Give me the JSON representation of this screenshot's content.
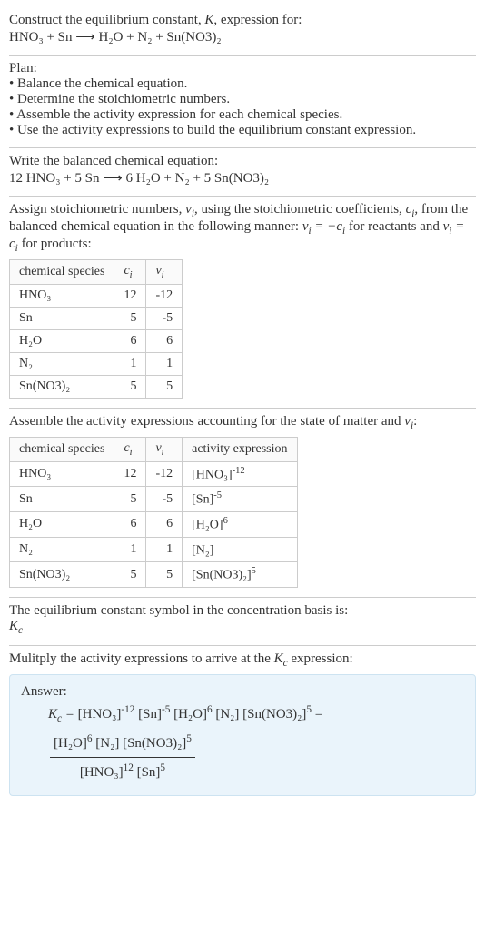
{
  "header": {
    "line1": "Construct the equilibrium constant, K, expression for:",
    "line2": "HNO₃ + Sn ⟶ H₂O + N₂ + Sn(NO3)₂"
  },
  "plan": {
    "title": "Plan:",
    "b1": "• Balance the chemical equation.",
    "b2": "• Determine the stoichiometric numbers.",
    "b3": "• Assemble the activity expression for each chemical species.",
    "b4": "• Use the activity expressions to build the equilibrium constant expression."
  },
  "balanced": {
    "title": "Write the balanced chemical equation:",
    "eq": "12 HNO₃ + 5 Sn ⟶ 6 H₂O + N₂ + 5 Sn(NO3)₂"
  },
  "stoich": {
    "intro_a": "Assign stoichiometric numbers, ",
    "intro_b": ", using the stoichiometric coefficients, ",
    "intro_c": ", from the balanced chemical equation in the following manner: ",
    "intro_d": " for reactants and ",
    "intro_e": " for products:",
    "table": {
      "h1": "chemical species",
      "h2": "cᵢ",
      "h3": "νᵢ",
      "rows": [
        {
          "sp": "HNO₃",
          "c": "12",
          "v": "-12"
        },
        {
          "sp": "Sn",
          "c": "5",
          "v": "-5"
        },
        {
          "sp": "H₂O",
          "c": "6",
          "v": "6"
        },
        {
          "sp": "N₂",
          "c": "1",
          "v": "1"
        },
        {
          "sp": "Sn(NO3)₂",
          "c": "5",
          "v": "5"
        }
      ]
    }
  },
  "activity": {
    "intro_a": "Assemble the activity expressions accounting for the state of matter and ",
    "intro_b": ":",
    "table": {
      "h1": "chemical species",
      "h2": "cᵢ",
      "h3": "νᵢ",
      "h4": "activity expression",
      "rows": [
        {
          "sp": "HNO₃",
          "c": "12",
          "v": "-12",
          "act_base": "[HNO₃]",
          "act_exp": "-12"
        },
        {
          "sp": "Sn",
          "c": "5",
          "v": "-5",
          "act_base": "[Sn]",
          "act_exp": "-5"
        },
        {
          "sp": "H₂O",
          "c": "6",
          "v": "6",
          "act_base": "[H₂O]",
          "act_exp": "6"
        },
        {
          "sp": "N₂",
          "c": "1",
          "v": "1",
          "act_base": "[N₂]",
          "act_exp": ""
        },
        {
          "sp": "Sn(NO3)₂",
          "c": "5",
          "v": "5",
          "act_base": "[Sn(NO3)₂]",
          "act_exp": "5"
        }
      ]
    }
  },
  "symbol": {
    "line": "The equilibrium constant symbol in the concentration basis is:",
    "sym": "K_c"
  },
  "multiply": {
    "line_a": "Mulitply the activity expressions to arrive at the ",
    "line_b": " expression:"
  },
  "answer": {
    "label": "Answer:",
    "lhs": "K_c = ",
    "t1b": "[HNO₃]",
    "t1e": "-12",
    "t2b": "[Sn]",
    "t2e": "-5",
    "t3b": "[H₂O]",
    "t3e": "6",
    "t4b": "[N₂]",
    "t4e": "",
    "t5b": "[Sn(NO3)₂]",
    "t5e": "5",
    "eq": " = ",
    "num1b": "[H₂O]",
    "num1e": "6",
    "num2b": "[N₂]",
    "num2e": "",
    "num3b": "[Sn(NO3)₂]",
    "num3e": "5",
    "den1b": "[HNO₃]",
    "den1e": "12",
    "den2b": "[Sn]",
    "den2e": "5"
  }
}
